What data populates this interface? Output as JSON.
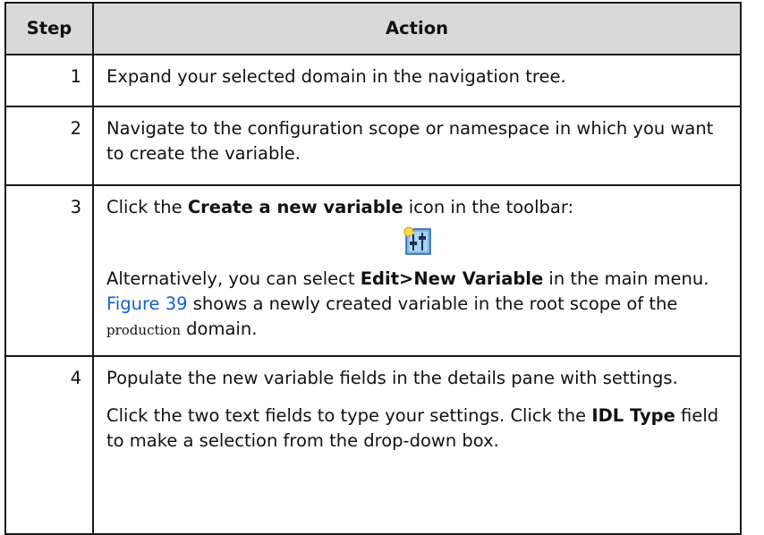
{
  "table": {
    "headers": {
      "step": "Step",
      "action": "Action"
    },
    "rows": [
      {
        "step": "1",
        "text": "Expand your selected domain in the navigation tree."
      },
      {
        "step": "2",
        "text": "Navigate to the configuration scope or namespace in which you want to create the variable."
      },
      {
        "step": "3",
        "p1_pre": "Click the ",
        "p1_bold": "Create a new variable",
        "p1_post": " icon in the toolbar:",
        "icon": "new-variable-icon",
        "p2_pre": "Alternatively, you can select ",
        "p2_bold": "Edit>New Variable",
        "p2_mid": " in the main menu. ",
        "p2_link": "Figure 39",
        "p2_post1": " shows a newly created variable in the root scope of the ",
        "p2_code": "production",
        "p2_post2": " domain."
      },
      {
        "step": "4",
        "p1": "Populate the new variable fields in the details pane with settings.",
        "p2_pre": "Click the two text fields to type your settings. Click the ",
        "p2_bold": "IDL Type",
        "p2_post": " field to make a selection from the drop-down box."
      }
    ]
  },
  "colors": {
    "header_bg": "#d9d9d9",
    "border": "#1a1a1a",
    "link": "#1a5fd0"
  }
}
